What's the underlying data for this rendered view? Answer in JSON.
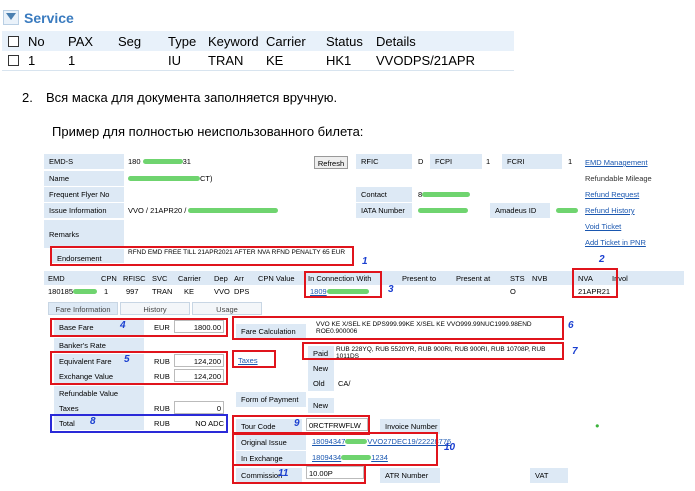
{
  "service": {
    "title": "Service",
    "columns": [
      "No",
      "PAX",
      "Seg",
      "Type",
      "Keyword",
      "Carrier",
      "Status",
      "Details"
    ],
    "rows": [
      [
        "1",
        "1",
        "",
        "IU",
        "TRAN",
        "KE",
        "HK1",
        "VVODPS/21APR"
      ]
    ]
  },
  "step": {
    "number": "2.",
    "text": "Вся маска для документа заполняется вручную."
  },
  "example_text": "Пример для полностью неиспользованного билета:",
  "emd": {
    "emd_s_label": "EMD-S",
    "emd_s_value": "180",
    "emd_s_tail": "31",
    "refresh": "Refresh",
    "rfic_label": "RFIC",
    "rfic_value": "D",
    "fcpi_label": "FCPI",
    "fcpi_value": "1",
    "fcri_label": "FCRI",
    "fcri_value": "1",
    "name_label": "Name",
    "name_tail": "CT)",
    "ffn_label": "Frequent Flyer No",
    "contact_label": "Contact",
    "contact_value": "8",
    "issue_label": "Issue Information",
    "issue_value": "VVO / 21APR20 /",
    "iata_label": "IATA Number",
    "amadeus_label": "Amadeus ID",
    "remarks_label": "Remarks",
    "endorsement_label": "Endorsement",
    "endorsement_value": "RFND EMD FREE TILL 21APR2021 AFTER NVA RFND PENALTY 65 EUR",
    "links": [
      "EMD Management",
      "Refundable Mileage",
      "Refund Request",
      "Refund History",
      "Void Ticket",
      "Add Ticket in PNR"
    ],
    "coupon_headers": [
      "EMD",
      "CPN",
      "RFISC",
      "SVC",
      "Carrier",
      "Dep",
      "Arr",
      "CPN Value",
      "In Connection With",
      "Present to",
      "Present at",
      "STS",
      "NVB",
      "NVA",
      "Invol"
    ],
    "coupon_values": {
      "emd": "180185",
      "cpn": "1",
      "rfisc": "997",
      "svc": "TRAN",
      "carrier": "KE",
      "dep": "VVO",
      "arr": "DPS",
      "conn": "1809",
      "sts": "O",
      "nva": "21APR21"
    },
    "tabs": [
      "Fare Information",
      "History",
      "Usage"
    ],
    "base_fare_label": "Base Fare",
    "base_fare_cur": "EUR",
    "base_fare_amount": "1800.00",
    "bankers_rate_label": "Banker's Rate",
    "equiv_label": "Equivalent Fare",
    "equiv_cur": "RUB",
    "equiv_amount": "124,200",
    "exchange_label": "Exchange Value",
    "exchange_cur": "RUB",
    "exchange_amount": "124,200",
    "refundable_label": "Refundable Value",
    "taxes_label": "Taxes",
    "taxes_cur": "RUB",
    "taxes_amount": "0",
    "total_label": "Total",
    "total_cur": "RUB",
    "total_amount": "NO ADC",
    "fare_calc_label": "Fare Calculation",
    "fare_calc_value1": "VVO KE X/SEL KE DPS999.99KE X/SEL KE VVO999.99NUC1999.98END ROE0.900006",
    "taxes_link": "Taxes",
    "paid_label": "Paid",
    "paid_value": "RUB 228YQ, RUB 5520YR, RUB 900RI, RUB 900RI, RUB 10708P, RUB 1011DS",
    "new_label": "New",
    "old_label": "Old",
    "old_value": "CA/",
    "form_payment_label": "Form of Payment",
    "new2_label": "New",
    "tour_code_label": "Tour Code",
    "tour_code_value": "0RCTFRWFLW",
    "invoice_label": "Invoice Number",
    "original_issue_label": "Original Issue",
    "original_issue_value": "18094347",
    "original_issue_tail": "VVO27DEC19/22228776",
    "in_exchange_label": "In Exchange",
    "in_exchange_value": "1809434",
    "in_exchange_tail": "1234",
    "commission_label": "Commission",
    "commission_value": "10.00P",
    "atr_label": "ATR Number",
    "vat_label": "VAT",
    "annotations": [
      "1",
      "2",
      "3",
      "4",
      "5",
      "6",
      "7",
      "8",
      "9",
      "10",
      "11"
    ]
  },
  "colors": {
    "accent": "#3a7bbf",
    "highlight_red": "#e0141c",
    "highlight_blue": "#2a2ad8",
    "label_bg": "#dde9f5"
  }
}
